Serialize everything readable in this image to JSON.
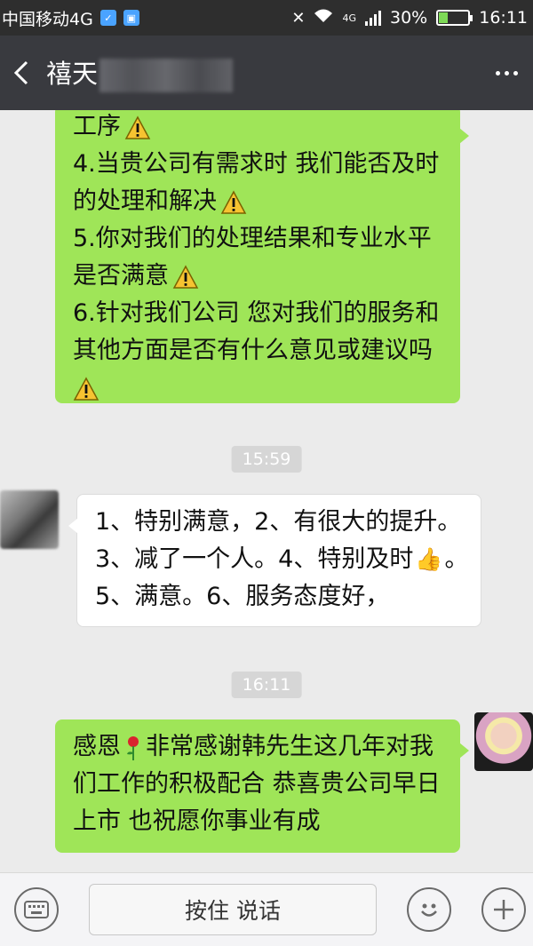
{
  "status_bar": {
    "carrier": "中国移动4G",
    "network_label": "4G",
    "battery": "30%",
    "battery_level": 0.3,
    "time": "16:11"
  },
  "header": {
    "title": "禧天",
    "back_icon": "back-arrow-icon",
    "more_icon": "more-dots-icon"
  },
  "messages": [
    {
      "direction": "outgoing",
      "lines": [
        "工序",
        "4.当贵公司有需求时 我们能否及时",
        "的处理和解决",
        "5.你对我们的处理结果和专业水平",
        "是否满意",
        "6.针对我们公司 您对我们的服务和",
        "其他方面是否有什么意见或建议吗",
        ""
      ]
    },
    {
      "type": "timestamp",
      "text": "15:59"
    },
    {
      "direction": "incoming",
      "lines": [
        "1、特别满意，2、有很大的提升。",
        "3、减了一个人。4、特别及时",
        "。",
        "5、满意。6、服务态度好，"
      ]
    },
    {
      "type": "timestamp",
      "text": "16:11"
    },
    {
      "direction": "outgoing",
      "lines": [
        "感恩",
        "非常感谢韩先生这几年对我",
        "们工作的积极配合 恭喜贵公司早日",
        "上市 也祝愿你事业有成"
      ]
    }
  ],
  "input_bar": {
    "voice_button_label": "按住 说话",
    "keyboard_icon": "keyboard-icon",
    "emoji_icon": "emoji-icon",
    "plus_icon": "plus-icon"
  },
  "colors": {
    "outgoing_bubble": "#9fe558",
    "incoming_bubble": "#ffffff",
    "header_bg": "#393a3f",
    "chat_bg": "#ebebeb"
  }
}
